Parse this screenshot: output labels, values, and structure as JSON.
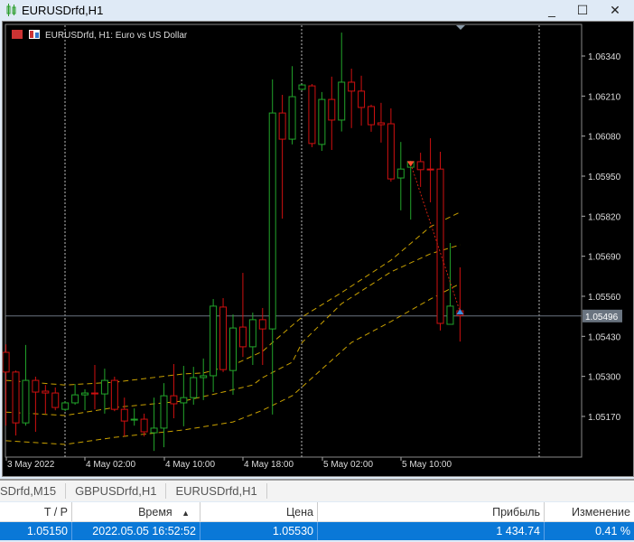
{
  "window": {
    "title": "EURUSDrfd,H1",
    "minimize": "_",
    "maximize": "☐",
    "close": "✕"
  },
  "chart": {
    "legend": "EURUSDrfd, H1:  Euro vs US Dollar",
    "current_price": "1.05496",
    "price_labels": [
      "1.06340",
      "1.06210",
      "1.06080",
      "1.05950",
      "1.05820",
      "1.05690",
      "1.05560",
      "1.05430",
      "1.05300",
      "1.05170"
    ],
    "time_labels": [
      "3 May 2022",
      "4 May 02:00",
      "4 May 10:00",
      "4 May 18:00",
      "5 May 02:00",
      "5 May 10:00"
    ],
    "colors": {
      "bull": "#22a52b",
      "bear": "#d01010",
      "band": "#c8a000",
      "grid": "#ffffff"
    }
  },
  "chart_data": {
    "type": "candlestick",
    "symbol": "EURUSDrfd",
    "timeframe": "H1",
    "ylim": [
      1.0505,
      1.0651
    ],
    "candles": [
      [
        1.05378,
        1.05404,
        1.0514,
        1.05314
      ],
      [
        1.05314,
        1.05319,
        1.05108,
        1.05149
      ],
      [
        1.05149,
        1.05402,
        1.0514,
        1.05287
      ],
      [
        1.05287,
        1.05299,
        1.0512,
        1.05249
      ],
      [
        1.05252,
        1.05272,
        1.05179,
        1.05246
      ],
      [
        1.05246,
        1.05264,
        1.0519,
        1.05199
      ],
      [
        1.05193,
        1.0522,
        1.05187,
        1.05214
      ],
      [
        1.05214,
        1.05275,
        1.05208,
        1.0524
      ],
      [
        1.0524,
        1.05258,
        1.0519,
        1.05246
      ],
      [
        1.05246,
        1.05337,
        1.05193,
        1.05243
      ],
      [
        1.05243,
        1.05325,
        1.05179,
        1.05287
      ],
      [
        1.05287,
        1.05299,
        1.05187,
        1.05193
      ],
      [
        1.05193,
        1.05231,
        1.05105,
        1.05155
      ],
      [
        1.05158,
        1.05196,
        1.0514,
        1.05161
      ],
      [
        1.05161,
        1.05179,
        1.05105,
        1.0512
      ],
      [
        1.05117,
        1.05231,
        1.05058,
        1.05132
      ],
      [
        1.05132,
        1.05278,
        1.0507,
        1.05237
      ],
      [
        1.05237,
        1.0534,
        1.05164,
        1.05211
      ],
      [
        1.05214,
        1.05334,
        1.05138,
        1.05231
      ],
      [
        1.05231,
        1.05331,
        1.05208,
        1.05296
      ],
      [
        1.05296,
        1.05358,
        1.05223,
        1.05302
      ],
      [
        1.05302,
        1.05551,
        1.05249,
        1.05528
      ],
      [
        1.05525,
        1.05554,
        1.05314,
        1.05322
      ],
      [
        1.05319,
        1.05501,
        1.0524,
        1.05457
      ],
      [
        1.0546,
        1.05636,
        1.05363,
        1.05396
      ],
      [
        1.05396,
        1.05507,
        1.05337,
        1.05484
      ],
      [
        1.05484,
        1.05522,
        1.05337,
        1.05454
      ],
      [
        1.05454,
        1.06264,
        1.05176,
        1.06155
      ],
      [
        1.06155,
        1.06214,
        1.05812,
        1.0607
      ],
      [
        1.0607,
        1.06307,
        1.06053,
        1.06208
      ],
      [
        1.06232,
        1.06249,
        1.06229,
        1.06246
      ],
      [
        1.06243,
        1.06249,
        1.06044,
        1.06056
      ],
      [
        1.06053,
        1.06223,
        1.06032,
        1.06199
      ],
      [
        1.06199,
        1.06273,
        1.06035,
        1.06132
      ],
      [
        1.06132,
        1.06416,
        1.06095,
        1.06255
      ],
      [
        1.06255,
        1.06299,
        1.06106,
        1.06226
      ],
      [
        1.06226,
        1.06276,
        1.06114,
        1.06173
      ],
      [
        1.06176,
        1.06182,
        1.06094,
        1.06117
      ],
      [
        1.06123,
        1.06188,
        1.06059,
        1.06117
      ],
      [
        1.0612,
        1.0617,
        1.05932,
        1.05941
      ],
      [
        1.05944,
        1.06061,
        1.05839,
        1.05973
      ],
      [
        1.05979,
        1.06,
        1.05809,
        1.05997
      ],
      [
        1.05997,
        1.06026,
        1.05915,
        1.05971
      ],
      [
        1.05973,
        1.06073,
        1.05865,
        1.05971
      ],
      [
        1.05973,
        1.06029,
        1.05449,
        1.05472
      ],
      [
        1.05469,
        1.05733,
        1.05469,
        1.05528
      ],
      [
        1.05513,
        1.05654,
        1.05413,
        1.05498
      ]
    ],
    "bands": [
      {
        "name": "upper",
        "points": [
          [
            0,
            1.05287
          ],
          [
            6,
            1.05272
          ],
          [
            11,
            1.05281
          ],
          [
            18,
            1.05308
          ],
          [
            20,
            1.05311
          ],
          [
            23,
            1.05337
          ],
          [
            26,
            1.05381
          ],
          [
            27,
            1.0541
          ],
          [
            30,
            1.05493
          ],
          [
            34,
            1.05572
          ],
          [
            39,
            1.05677
          ],
          [
            43,
            1.05786
          ],
          [
            46,
            1.05833
          ]
        ]
      },
      {
        "name": "middle",
        "points": [
          [
            0,
            1.05184
          ],
          [
            6,
            1.05173
          ],
          [
            11,
            1.05199
          ],
          [
            18,
            1.0522
          ],
          [
            22,
            1.05249
          ],
          [
            25,
            1.05272
          ],
          [
            26,
            1.05296
          ],
          [
            29,
            1.05346
          ],
          [
            30,
            1.0541
          ],
          [
            34,
            1.05536
          ],
          [
            39,
            1.05639
          ],
          [
            43,
            1.05698
          ],
          [
            46,
            1.05727
          ]
        ]
      },
      {
        "name": "lower",
        "points": [
          [
            0,
            1.05091
          ],
          [
            6,
            1.05079
          ],
          [
            11,
            1.05102
          ],
          [
            18,
            1.05126
          ],
          [
            23,
            1.05152
          ],
          [
            26,
            1.0519
          ],
          [
            29,
            1.05237
          ],
          [
            35,
            1.0541
          ],
          [
            39,
            1.05478
          ],
          [
            43,
            1.05551
          ],
          [
            46,
            1.05601
          ]
        ]
      }
    ],
    "trade": {
      "open_index": 41,
      "open_price": 1.0599,
      "close_index": 46,
      "close_price": 1.0551
    }
  },
  "tabs": [
    "SDrfd,M15",
    "GBPUSDrfd,H1",
    "EURUSDrfd,H1"
  ],
  "table": {
    "headers": [
      "T / P",
      "Время",
      "Цена",
      "Прибыль",
      "Изменение"
    ],
    "sort_icon": "▲",
    "row": [
      "1.05150",
      "2022.05.05 16:52:52",
      "1.05530",
      "1 434.74",
      "0.41 %"
    ]
  }
}
